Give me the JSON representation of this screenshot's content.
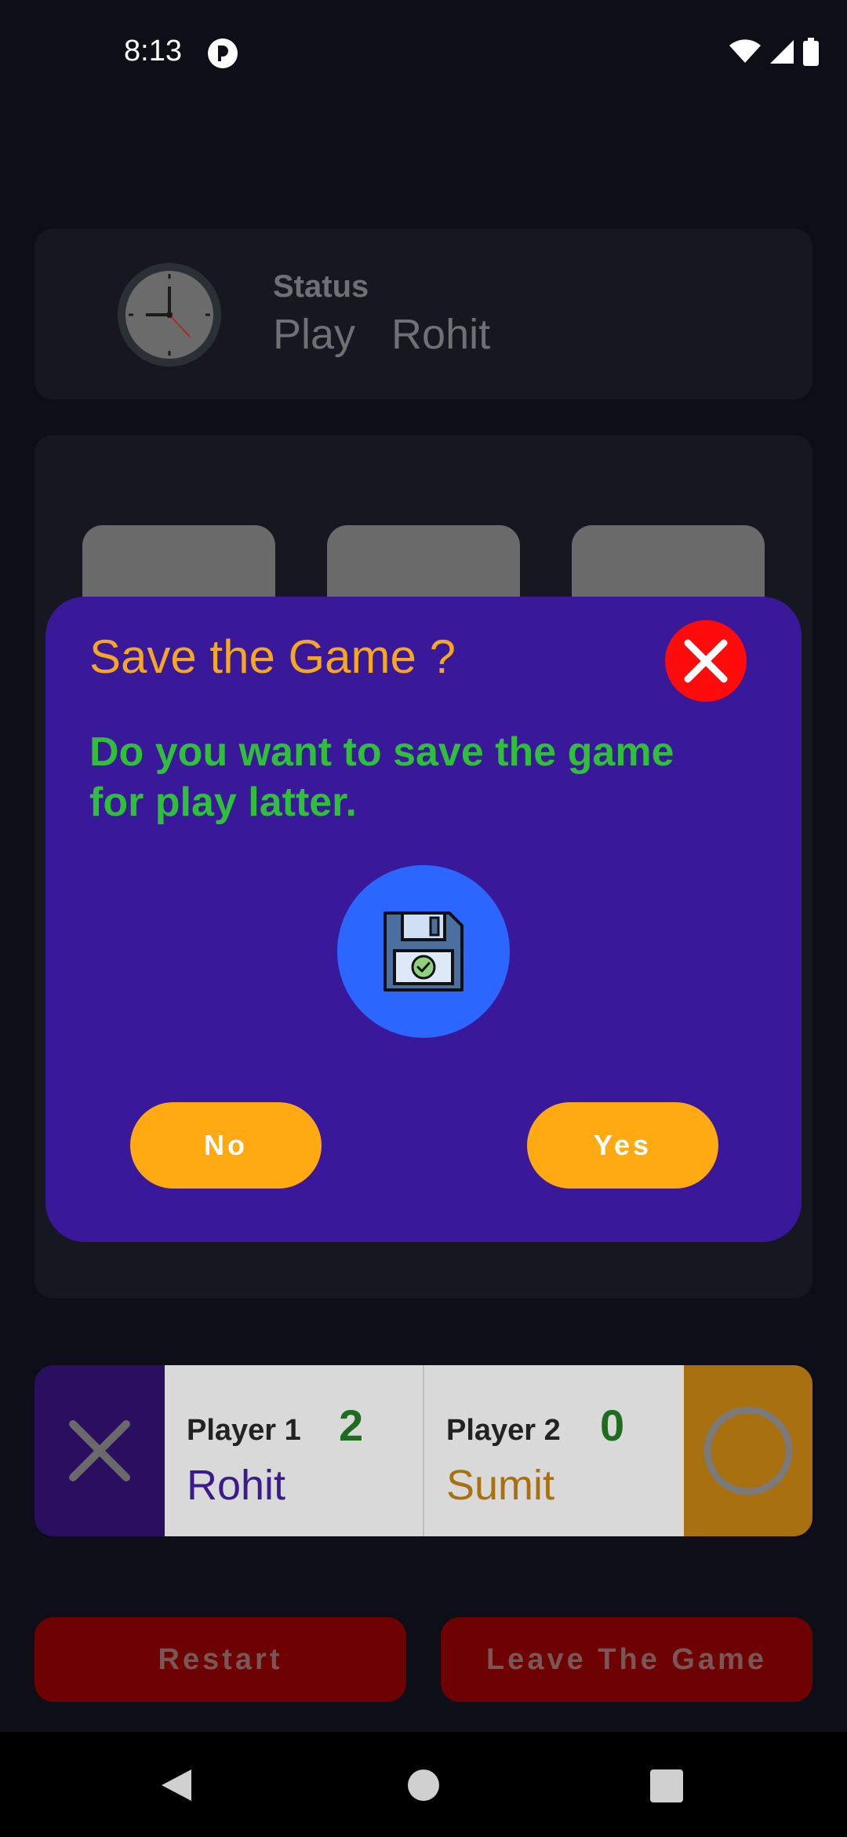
{
  "status_bar": {
    "time": "8:13"
  },
  "status_card": {
    "label": "Status",
    "state": "Play",
    "player": "Rohit"
  },
  "players": {
    "p1": {
      "label": "Player 1",
      "score": "2",
      "name": "Rohit",
      "name_color": "#3d1a8c"
    },
    "p2": {
      "label": "Player 2",
      "score": "0",
      "name": "Sumit",
      "name_color": "#a8700f"
    }
  },
  "buttons": {
    "restart": "Restart",
    "leave": "Leave The Game"
  },
  "dialog": {
    "title": "Save the Game ?",
    "message": "Do you want to save the game for play latter.",
    "no": "No",
    "yes": "Yes"
  },
  "colors": {
    "dialog_bg": "#3a189a",
    "accent_orange": "#ffaa12",
    "message_green": "#2fbf3a",
    "close_red": "#ff0b0b"
  },
  "icons": [
    "clock-icon",
    "close-icon",
    "floppy-disk-icon",
    "x-mark-icon",
    "o-mark-icon"
  ]
}
